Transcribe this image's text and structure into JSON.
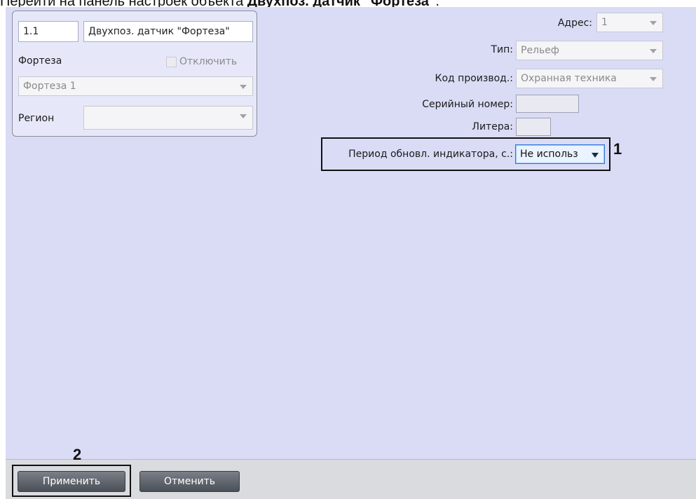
{
  "caption": {
    "prefix": "Перейти на панель настроек объекта ",
    "object": "Двухпоз. датчик \"Фортеза\"",
    "suffix": "."
  },
  "object": {
    "id": "1.1",
    "name": "Двухпоз. датчик \"Фортеза\""
  },
  "parent": {
    "label": "Фортеза",
    "disable_label": "Отключить",
    "value": "Фортеза 1"
  },
  "region": {
    "label": "Регион",
    "value": ""
  },
  "settings": {
    "address": {
      "label": "Адрес:",
      "value": "1"
    },
    "type": {
      "label": "Тип:",
      "value": "Рельеф"
    },
    "manufacturer": {
      "label": "Код производ.:",
      "value": "Охранная техника"
    },
    "serial": {
      "label": "Серийный номер:",
      "value": ""
    },
    "letter": {
      "label": "Литера:",
      "value": ""
    },
    "period": {
      "label": "Период обновл. индикатора, с.:",
      "value": "Не использ"
    }
  },
  "markers": {
    "one": "1",
    "two": "2"
  },
  "buttons": {
    "apply": "Применить",
    "cancel": "Отменить"
  },
  "icons": {
    "dropdown": "chevron-down-icon"
  }
}
